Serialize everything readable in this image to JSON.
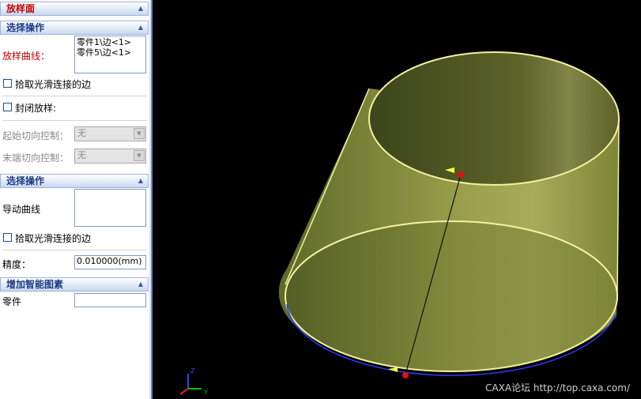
{
  "panel": {
    "title": "放样面",
    "section1": {
      "header": "选择操作",
      "curve_label": "放样曲线：",
      "curves": [
        "零件1\\边<1>",
        "零件5\\边<1>"
      ],
      "pick_smooth_label": "拾取光滑连接的边",
      "closed_label": "封闭放样:",
      "start_tangent_label": "起始切向控制：",
      "start_tangent_value": "无",
      "end_tangent_label": "末端切向控制：",
      "end_tangent_value": "无"
    },
    "section2": {
      "header": "选择操作",
      "guide_label": "导动曲线",
      "pick_smooth_label": "拾取光滑连接的边",
      "precision_label": "精度：",
      "precision_value": "0.010000(mm)"
    },
    "section3": {
      "header": "增加智能图素",
      "part_label": "零件",
      "part_value": ""
    }
  },
  "viewport": {
    "watermark": "CAXA论坛 http://top.caxa.com/",
    "axis_labels": {
      "z": "Z",
      "y": "Y"
    },
    "colors": {
      "background": "#000000",
      "surface": "#8c9440",
      "edge": "#f4f2a0",
      "point": "#e01010",
      "arrow": "#ffff40"
    }
  }
}
